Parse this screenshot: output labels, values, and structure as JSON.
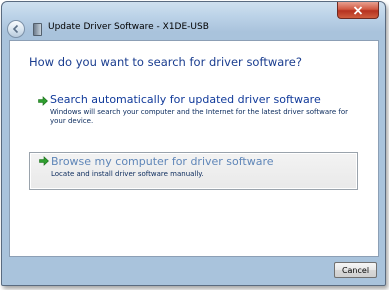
{
  "window": {
    "title": "Update Driver Software - X1DE-USB"
  },
  "main": {
    "heading": "How do you want to search for driver software?",
    "options": [
      {
        "title": "Search automatically for updated driver software",
        "description": "Windows will search your computer and the Internet for the latest driver software for your device.",
        "icon": "green-arrow-icon"
      },
      {
        "title": "Browse my computer for driver software",
        "description": "Locate and install driver software manually.",
        "icon": "green-arrow-icon"
      }
    ]
  },
  "footer": {
    "cancel_label": "Cancel"
  },
  "colors": {
    "heading": "#1a3d8f",
    "link": "#113a9a",
    "arrow": "#2f9e2f",
    "close_button": "#c0392b"
  }
}
